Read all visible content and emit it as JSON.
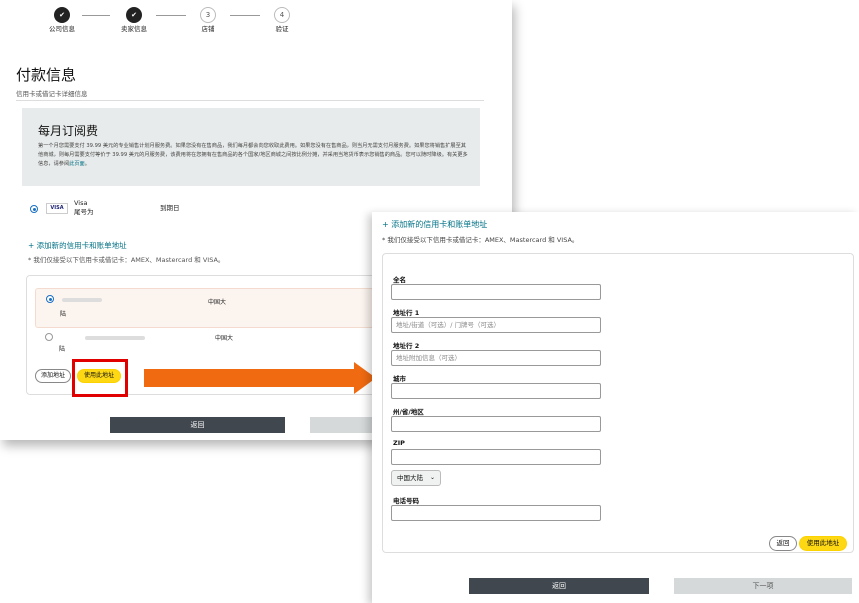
{
  "stepper": {
    "steps": [
      {
        "label": "公司信息",
        "number": "",
        "done": true
      },
      {
        "label": "卖家信息",
        "number": "",
        "done": true
      },
      {
        "label": "店铺",
        "number": "3",
        "done": false
      },
      {
        "label": "验证",
        "number": "4",
        "done": false
      }
    ]
  },
  "payment": {
    "title": "付款信息",
    "subtitle": "信用卡或借记卡详细信息"
  },
  "subscription": {
    "title": "每月订阅费",
    "description": "第一个月您需要支付 39.99 美元的专业销售计划月服务费。如果您没有在售商品，我们每月都会向您收取此费用。如果您没有在售商品，则当月无需支付月服务费。如果您将销售扩展至其他商城，则每月需要支付等价于 39.99 美元的月服务费，该费用将在您拥有在售商品的各个国家/地区商城之间按比例分摊，并采用当地货币表示您销售的商品。您可以随时降级。有关更多信息，请参阅",
    "link": "此页面"
  },
  "card": {
    "brand": "VISA",
    "name": "Visa",
    "tail_label": "尾号为",
    "expiry_label": "到期日"
  },
  "left_panel": {
    "add_card_link": "+ 添加新的信用卡和账单地址",
    "accepted_cards": "* 我们仅接受以下信用卡或借记卡：AMEX、Mastercard 和 VISA。",
    "address_1_region": "中国大",
    "address_1_suffix": "陆",
    "address_2_region": "中国大",
    "address_2_suffix": "陆",
    "add_address_button": "添加地址",
    "use_address_button": "使用此地址",
    "back_button": "返回"
  },
  "right_panel": {
    "add_card_link": "+ 添加新的信用卡和账单地址",
    "accepted_cards": "* 我们仅接受以下信用卡或借记卡：AMEX、Mastercard 和 VISA。",
    "fields": {
      "full_name_label": "全名",
      "address1_label": "地址行 1",
      "address1_placeholder": "地址/街道（可选）/ 门牌号（可选）",
      "address2_label": "地址行 2",
      "address2_placeholder": "地址附加信息（可选）",
      "city_label": "城市",
      "state_label": "州/省/地区",
      "zip_label": "ZIP",
      "country_value": "中国大陆",
      "phone_label": "电话号码"
    },
    "back_small_button": "返回",
    "use_address_button": "使用此地址",
    "back_button": "返回",
    "next_button": "下一项"
  },
  "colors": {
    "arrow": "#f06a11",
    "highlight_box": "#e00000",
    "primary_button": "#ffd814",
    "link": "#007185"
  }
}
